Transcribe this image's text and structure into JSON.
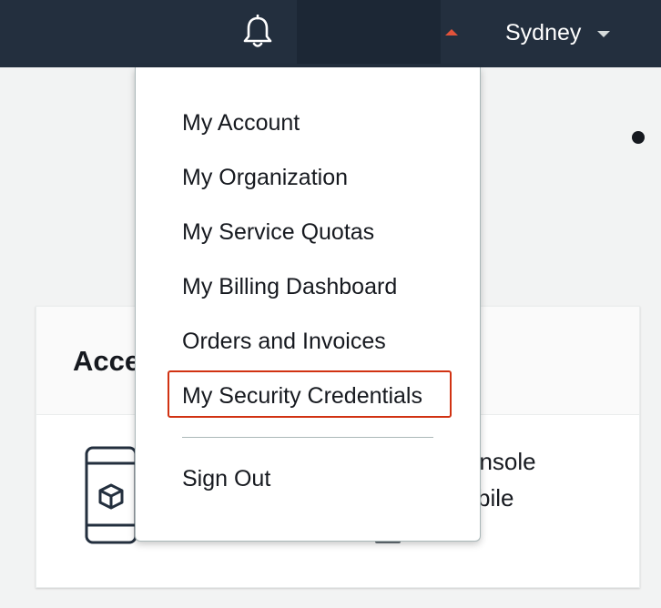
{
  "topbar": {
    "notifications_icon": "bell-icon",
    "account_caret_icon": "caret-up-icon",
    "region_label": "Sydney",
    "region_caret_icon": "caret-down-icon"
  },
  "dropdown": {
    "items": [
      {
        "label": "My Account"
      },
      {
        "label": "My Organization"
      },
      {
        "label": "My Service Quotas"
      },
      {
        "label": "My Billing Dashboard"
      },
      {
        "label": "Orders and Invoices"
      },
      {
        "label": "My Security Credentials",
        "highlighted": true
      }
    ],
    "sign_out": "Sign Out"
  },
  "card": {
    "title_fragment": "Acce",
    "side_line_1": "onsole",
    "side_line_2": "bile",
    "app_icon": "mobile-app-icon"
  },
  "colors": {
    "topbar": "#232f3e",
    "highlight_border": "#d13212",
    "caret_accent": "#e0533b"
  }
}
